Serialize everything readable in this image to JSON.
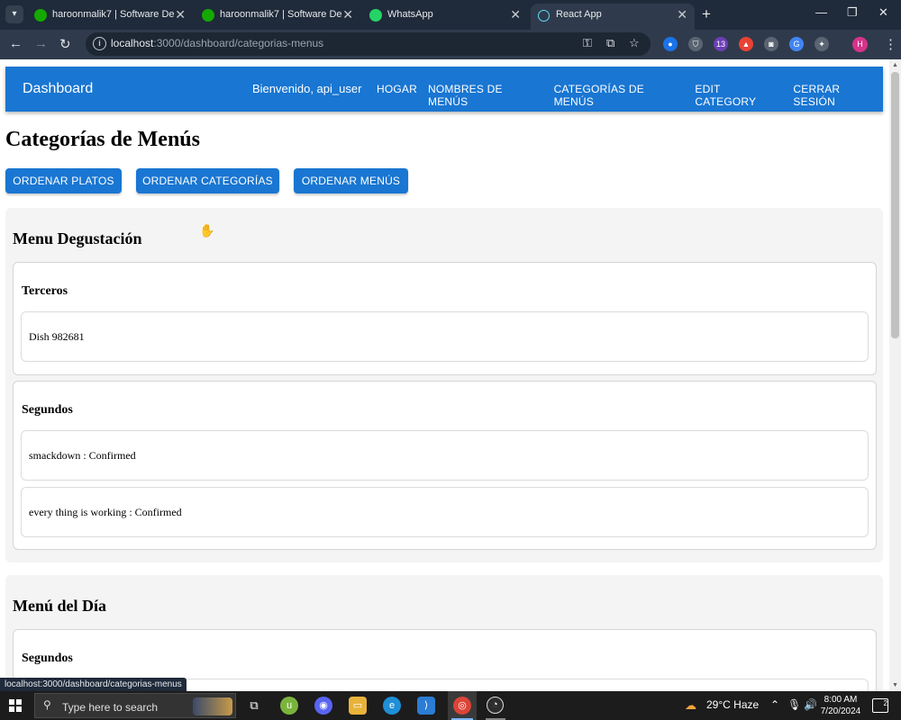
{
  "browser": {
    "tabs": [
      {
        "title": "haroonmalik7 | Software Develo",
        "favicon": "upwork-icon",
        "favicon_color": "#14a800",
        "active": false
      },
      {
        "title": "haroonmalik7 | Software Develo",
        "favicon": "upwork-icon",
        "favicon_color": "#14a800",
        "active": false
      },
      {
        "title": "WhatsApp",
        "favicon": "whatsapp-icon",
        "favicon_color": "#25d366",
        "active": false
      },
      {
        "title": "React App",
        "favicon": "react-icon",
        "favicon_color": "#61dafb",
        "active": true
      }
    ],
    "url_host": "localhost",
    "url_path": ":3000/dashboard/categorias-menus",
    "extension_badge": "13",
    "profile_initial": "H",
    "status_url": "localhost:3000/dashboard/categorias-menus"
  },
  "app": {
    "brand": "Dashboard",
    "welcome": "Bienvenido, api_user",
    "nav": [
      "HOGAR",
      "NOMBRES DE MENÚS",
      "CATEGORÍAS DE MENÚS",
      "EDIT CATEGORY",
      "CERRAR SESIÓN"
    ],
    "accent": "#1976d2",
    "page_title": "Categorías de Menús",
    "buttons": [
      "ORDENAR PLATOS",
      "ORDENAR CATEGORÍAS",
      "ORDENAR MENÚS"
    ],
    "menus": [
      {
        "name": "Menu Degustación",
        "categories": [
          {
            "name": "Terceros",
            "dishes": [
              "Dish 982681"
            ]
          },
          {
            "name": "Segundos",
            "dishes": [
              "smackdown : Confirmed",
              "every thing is working : Confirmed"
            ]
          }
        ]
      },
      {
        "name": "Menú del Día",
        "categories": [
          {
            "name": "Segundos",
            "dishes": []
          }
        ]
      }
    ]
  },
  "taskbar": {
    "search_placeholder": "Type here to search",
    "weather": "29°C  Haze",
    "time": "8:00 AM",
    "date": "7/20/2024",
    "notifications": "2"
  }
}
